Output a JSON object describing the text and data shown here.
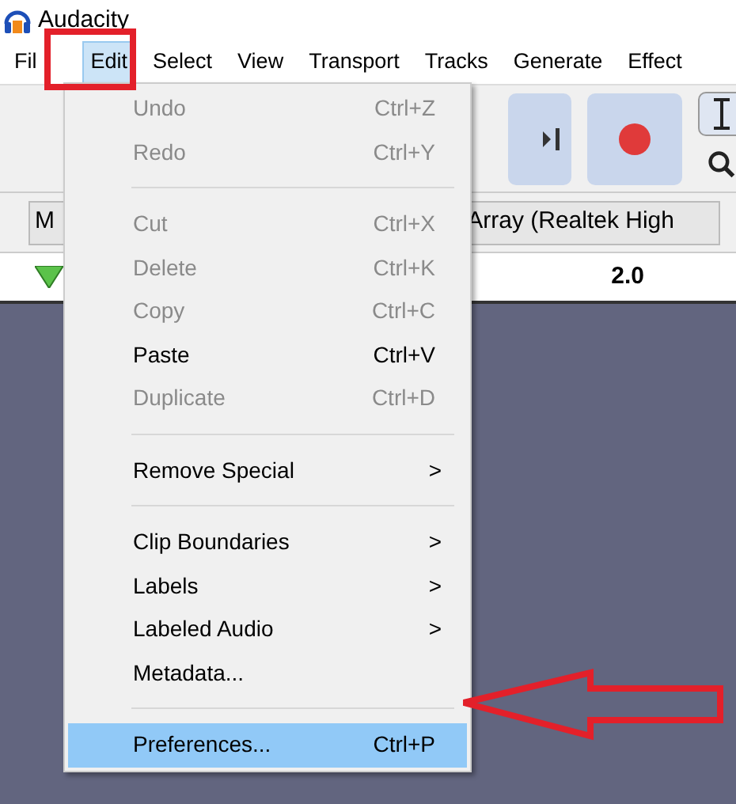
{
  "window": {
    "title": "Audacity"
  },
  "menubar": [
    {
      "label": "Fil",
      "selected": false
    },
    {
      "label": "Edit",
      "selected": true
    },
    {
      "label": "Select",
      "selected": false
    },
    {
      "label": "View",
      "selected": false
    },
    {
      "label": "Transport",
      "selected": false
    },
    {
      "label": "Tracks",
      "selected": false
    },
    {
      "label": "Generate",
      "selected": false
    },
    {
      "label": "Effect",
      "selected": false
    }
  ],
  "device_bar": {
    "left_text": "M",
    "right_text": "Array (Realtek High"
  },
  "ruler": {
    "tick_label": "2.0"
  },
  "edit_menu": [
    {
      "kind": "item",
      "label": "Undo",
      "shortcut": "Ctrl+Z",
      "disabled": true,
      "selected": false
    },
    {
      "kind": "item",
      "label": "Redo",
      "shortcut": "Ctrl+Y",
      "disabled": true,
      "selected": false
    },
    {
      "kind": "separator"
    },
    {
      "kind": "item",
      "label": "Cut",
      "shortcut": "Ctrl+X",
      "disabled": true,
      "selected": false
    },
    {
      "kind": "item",
      "label": "Delete",
      "shortcut": "Ctrl+K",
      "disabled": true,
      "selected": false
    },
    {
      "kind": "item",
      "label": "Copy",
      "shortcut": "Ctrl+C",
      "disabled": true,
      "selected": false
    },
    {
      "kind": "item",
      "label": "Paste",
      "shortcut": "Ctrl+V",
      "disabled": false,
      "selected": false
    },
    {
      "kind": "item",
      "label": "Duplicate",
      "shortcut": "Ctrl+D",
      "disabled": true,
      "selected": false
    },
    {
      "kind": "separator"
    },
    {
      "kind": "submenu",
      "label": "Remove Special",
      "arrow": ">",
      "disabled": false,
      "selected": false
    },
    {
      "kind": "separator"
    },
    {
      "kind": "submenu",
      "label": "Clip Boundaries",
      "arrow": ">",
      "disabled": false,
      "selected": false
    },
    {
      "kind": "submenu",
      "label": "Labels",
      "arrow": ">",
      "disabled": false,
      "selected": false
    },
    {
      "kind": "submenu",
      "label": "Labeled Audio",
      "arrow": ">",
      "disabled": false,
      "selected": false
    },
    {
      "kind": "item",
      "label": "Metadata...",
      "disabled": false,
      "selected": false
    },
    {
      "kind": "separator"
    },
    {
      "kind": "item",
      "label": "Preferences...",
      "shortcut": "Ctrl+P",
      "disabled": false,
      "selected": true
    }
  ],
  "annotations": {
    "edit_box": true,
    "preferences_arrow": true
  }
}
